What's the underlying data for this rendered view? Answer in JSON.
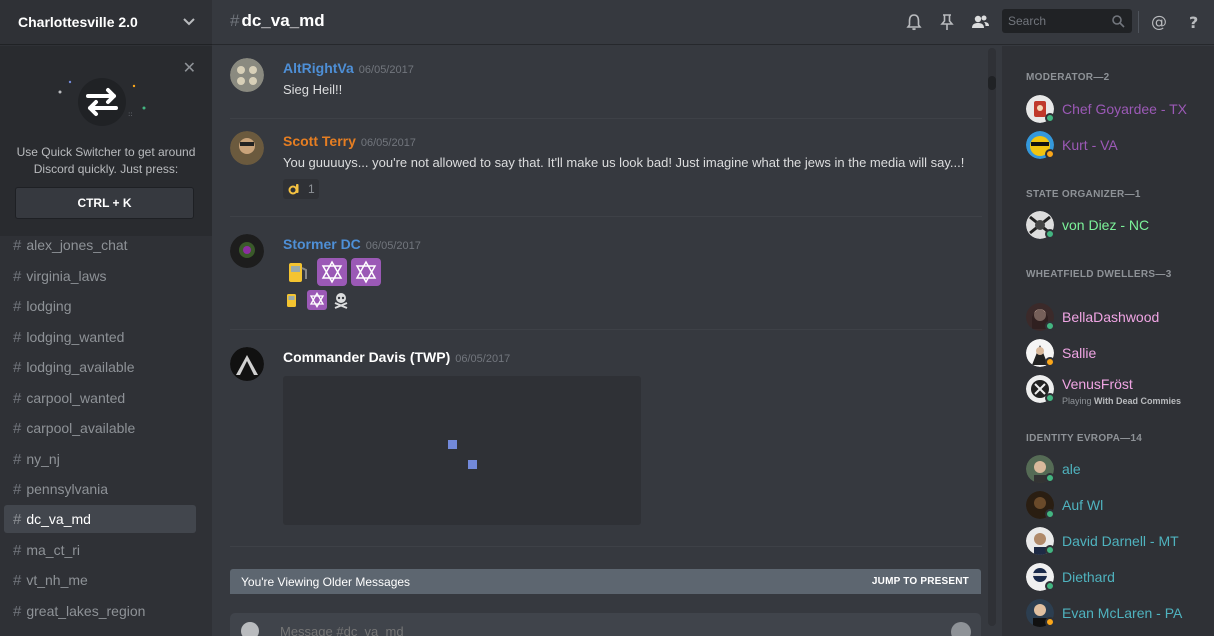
{
  "guild": {
    "name": "Charlottesville 2.0"
  },
  "quick_switcher": {
    "text": "Use Quick Switcher to get around Discord quickly. Just press:",
    "shortcut": "CTRL + K"
  },
  "channels": [
    {
      "name": "alex_jones_chat",
      "active": false
    },
    {
      "name": "virginia_laws",
      "active": false
    },
    {
      "name": "lodging",
      "active": false
    },
    {
      "name": "lodging_wanted",
      "active": false
    },
    {
      "name": "lodging_available",
      "active": false
    },
    {
      "name": "carpool_wanted",
      "active": false
    },
    {
      "name": "carpool_available",
      "active": false
    },
    {
      "name": "ny_nj",
      "active": false
    },
    {
      "name": "pennsylvania",
      "active": false
    },
    {
      "name": "dc_va_md",
      "active": true
    },
    {
      "name": "ma_ct_ri",
      "active": false
    },
    {
      "name": "vt_nh_me",
      "active": false
    },
    {
      "name": "great_lakes_region",
      "active": false
    }
  ],
  "header": {
    "channel": "dc_va_md",
    "search_placeholder": "Search",
    "icons": [
      "bell-icon",
      "pin-icon",
      "members-icon",
      "search-icon",
      "mention-icon",
      "help-icon"
    ]
  },
  "messages": [
    {
      "author": "AltRightVa",
      "color": "#4e8fd6",
      "time": "06/05/2017",
      "text": "Sieg Heil!!"
    },
    {
      "author": "Scott Terry",
      "color": "#e67e22",
      "time": "06/05/2017",
      "text": "You guuuuys... you're not allowed to say that. It'll make us look bad! Just imagine what the jews in the media will say...!",
      "reaction": {
        "emoji": "ok-hand-icon",
        "count": "1"
      }
    },
    {
      "author": "Stormer DC",
      "color": "#4e8fd6",
      "time": "06/05/2017",
      "emojis_row1": [
        "fuel-pump-icon",
        "star-of-david-icon",
        "star-of-david-icon"
      ],
      "emojis_row2": [
        "fuel-pump-icon",
        "star-of-david-icon",
        "skull-crossbones-icon"
      ]
    },
    {
      "author": "Commander Davis (TWP)",
      "color": "#ffffff",
      "time": "06/05/2017"
    }
  ],
  "older_bar": {
    "text": "You're Viewing Older Messages",
    "jump": "JUMP TO PRESENT"
  },
  "composer": {
    "placeholder": "Message #dc_va_md"
  },
  "member_groups": [
    {
      "title": "MODERATOR—2",
      "members": [
        {
          "name": "Chef Goyardee - TX",
          "color": "#9b59b6",
          "status": "online"
        },
        {
          "name": "Kurt - VA",
          "color": "#9b59b6",
          "status": "idle"
        }
      ]
    },
    {
      "title": "STATE ORGANIZER—1",
      "members": [
        {
          "name": "von Diez - NC",
          "color": "#7cf29a",
          "status": "online"
        }
      ]
    },
    {
      "title": "WHEATFIELD DWELLERS—3",
      "members": [
        {
          "name": "BellaDashwood",
          "color": "#f0a5e4",
          "status": "online"
        },
        {
          "name": "Sallie",
          "color": "#f0a5e4",
          "status": "idle"
        },
        {
          "name": "VenusFröst",
          "color": "#f0a5e4",
          "status": "online",
          "playing_label": "Playing",
          "playing_game": "With Dead Commies"
        }
      ]
    },
    {
      "title": "IDENTITY EVROPA—14",
      "members": [
        {
          "name": "ale",
          "color": "#4fb3bf",
          "status": "online"
        },
        {
          "name": "Auf Wl",
          "color": "#4fb3bf",
          "status": "online"
        },
        {
          "name": "David Darnell - MT",
          "color": "#4fb3bf",
          "status": "online"
        },
        {
          "name": "Diethard",
          "color": "#4fb3bf",
          "status": "online"
        },
        {
          "name": "Evan McLaren - PA",
          "color": "#4fb3bf",
          "status": "idle"
        }
      ]
    }
  ],
  "status_colors": {
    "online": "#43b581",
    "idle": "#faa61a"
  }
}
